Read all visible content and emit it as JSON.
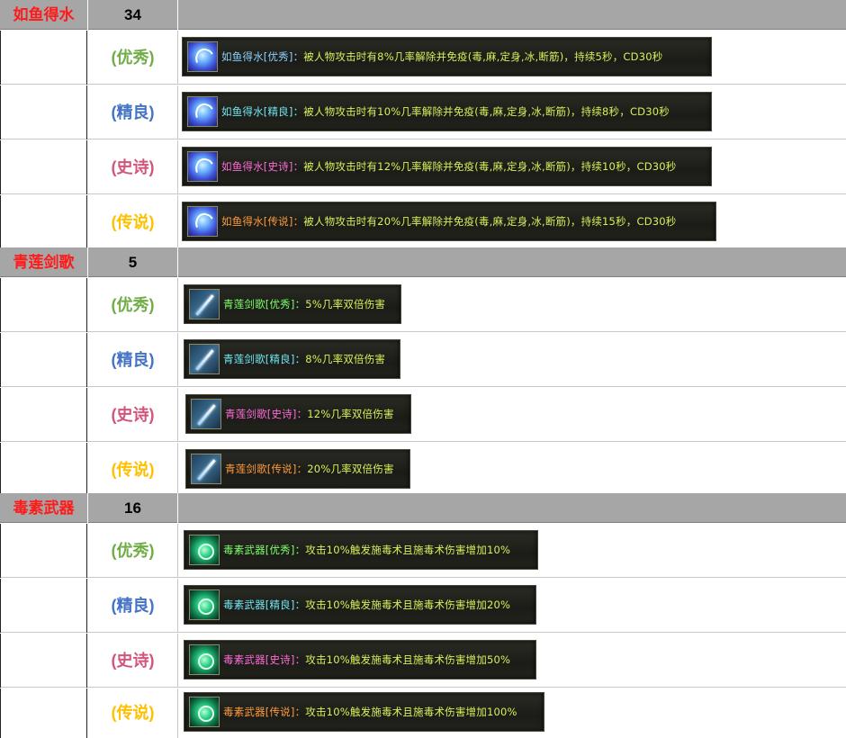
{
  "sections": [
    {
      "name": "如鱼得水",
      "count": "34",
      "icon": "water-swirl-icon",
      "rows": [
        {
          "quality": "(优秀)",
          "qclass": "q-excellent",
          "tip_name": "如鱼得水[优秀]：",
          "tip_desc": "被人物攻击时有8%几率解除并免疫(毒,麻,定身,冰,断筋)，持续5秒，CD30秒"
        },
        {
          "quality": "(精良)",
          "qclass": "q-fine",
          "tip_name": "如鱼得水[精良]：",
          "tip_desc": "被人物攻击时有10%几率解除并免疫(毒,麻,定身,冰,断筋)，持续8秒，CD30秒"
        },
        {
          "quality": "(史诗)",
          "qclass": "q-epic",
          "tip_name": "如鱼得水[史诗]：",
          "tip_desc": "被人物攻击时有12%几率解除并免疫(毒,麻,定身,冰,断筋)，持续10秒，CD30秒"
        },
        {
          "quality": "(传说)",
          "qclass": "q-legend",
          "tip_name": "如鱼得水[传说]：",
          "tip_desc": "被人物攻击时有20%几率解除并免疫(毒,麻,定身,冰,断筋)，持续15秒，CD30秒"
        }
      ]
    },
    {
      "name": "青莲剑歌",
      "count": "5",
      "icon": "sword-icon",
      "rows": [
        {
          "quality": "(优秀)",
          "qclass": "q-excellent",
          "tip_name": "青莲剑歌[优秀]：",
          "tip_desc": "5%几率双倍伤害"
        },
        {
          "quality": "(精良)",
          "qclass": "q-fine",
          "tip_name": "青莲剑歌[精良]：",
          "tip_desc": "8%几率双倍伤害"
        },
        {
          "quality": "(史诗)",
          "qclass": "q-epic",
          "tip_name": "青莲剑歌[史诗]：",
          "tip_desc": "12%几率双倍伤害"
        },
        {
          "quality": "(传说)",
          "qclass": "q-legend",
          "tip_name": "青莲剑歌[传说]：",
          "tip_desc": "20%几率双倍伤害"
        }
      ]
    },
    {
      "name": "毒素武器",
      "count": "16",
      "icon": "poison-orb-icon",
      "rows": [
        {
          "quality": "(优秀)",
          "qclass": "q-excellent",
          "tip_name": "毒素武器[优秀]：",
          "tip_desc": "攻击10%触发施毒术且施毒术伤害增加10%"
        },
        {
          "quality": "(精良)",
          "qclass": "q-fine",
          "tip_name": "毒素武器[精良]：",
          "tip_desc": "攻击10%触发施毒术且施毒术伤害增加20%"
        },
        {
          "quality": "(史诗)",
          "qclass": "q-epic",
          "tip_name": "毒素武器[史诗]：",
          "tip_desc": "攻击10%触发施毒术且施毒术伤害增加50%"
        },
        {
          "quality": "(传说)",
          "qclass": "q-legend",
          "tip_name": "毒素武器[传说]：",
          "tip_desc": "攻击10%触发施毒术且施毒术伤害增加100%"
        }
      ]
    }
  ]
}
